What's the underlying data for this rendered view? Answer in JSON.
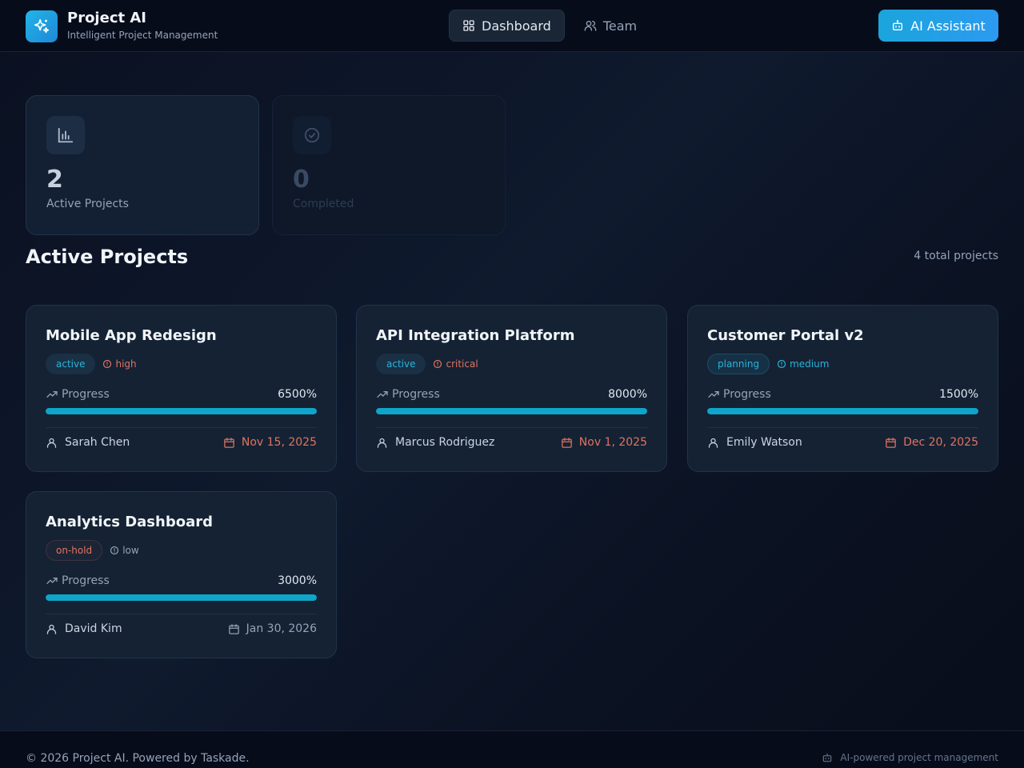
{
  "brand": {
    "title": "Project AI",
    "subtitle": "Intelligent Project Management"
  },
  "nav": {
    "dashboard": "Dashboard",
    "team": "Team",
    "ai_assistant": "AI Assistant"
  },
  "stats": [
    {
      "value": "2",
      "label": "Active Projects",
      "icon": "bar-chart-icon"
    },
    {
      "value": "0",
      "label": "Completed",
      "icon": "check-circle-icon"
    }
  ],
  "section": {
    "title": "Active Projects",
    "count": "4 total projects"
  },
  "projects": [
    {
      "name": "Mobile App Redesign",
      "status": "active",
      "priority": "high",
      "progress_label": "Progress",
      "progress": "6500%",
      "progress_fraction": 1.0,
      "owner": "Sarah Chen",
      "due": "Nov 15, 2025",
      "due_color": "#e0735f",
      "priority_color": "#e0735f"
    },
    {
      "name": "API Integration Platform",
      "status": "active",
      "priority": "critical",
      "progress_label": "Progress",
      "progress": "8000%",
      "progress_fraction": 1.0,
      "owner": "Marcus Rodriguez",
      "due": "Nov 1, 2025",
      "due_color": "#e0735f",
      "priority_color": "#e0735f"
    },
    {
      "name": "Customer Portal v2",
      "status": "planning",
      "priority": "medium",
      "progress_label": "Progress",
      "progress": "1500%",
      "progress_fraction": 1.0,
      "owner": "Emily Watson",
      "due": "Dec 20, 2025",
      "due_color": "#e0735f",
      "priority_color": "#2bb3d9"
    },
    {
      "name": "Analytics Dashboard",
      "status": "on-hold",
      "priority": "low",
      "progress_label": "Progress",
      "progress": "3000%",
      "progress_fraction": 1.0,
      "owner": "David Kim",
      "due": "Jan 30, 2026",
      "due_color": "#94a3b8",
      "priority_color": "#94a3b8"
    }
  ],
  "footer": {
    "copyright": "© 2026 Project AI. Powered by Taskade.",
    "tagline": "AI-powered project management"
  },
  "colors": {
    "accent": "#0ea5c9",
    "brand": "#1e88d6",
    "danger": "#e0735f"
  }
}
